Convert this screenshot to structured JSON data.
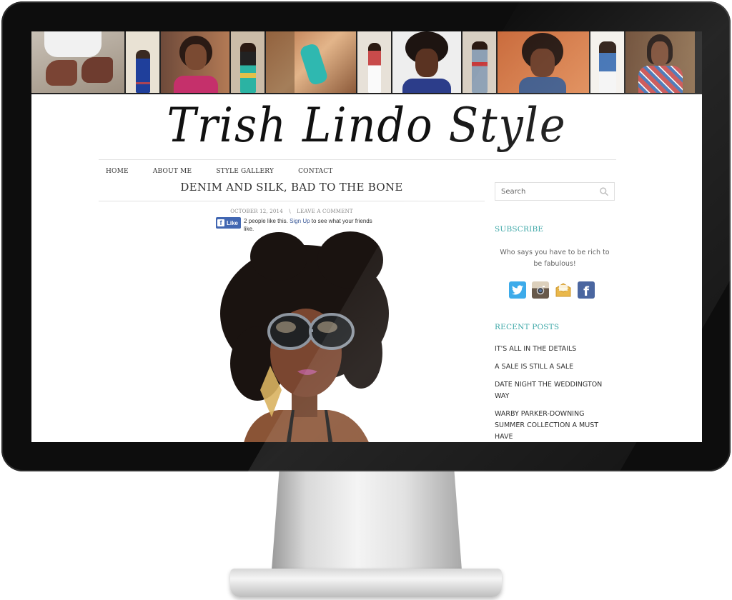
{
  "blog": {
    "title": "Trish Lindo Style"
  },
  "nav": {
    "items": [
      "HOME",
      "ABOUT ME",
      "STYLE GALLERY",
      "CONTACT"
    ]
  },
  "post": {
    "title": "DENIM AND SILK, BAD TO THE BONE",
    "date": "OCTOBER 12, 2014",
    "separator": "\\",
    "comment_link": "LEAVE A COMMENT",
    "fb": {
      "button": "Like",
      "count_text": "2 people like this.",
      "signup": "Sign Up",
      "rest": "to see what your friends like."
    }
  },
  "sidebar": {
    "search_placeholder": "Search",
    "subscribe_heading": "SUBSCRIBE",
    "subscribe_text": "Who says you have to be rich to be fabulous!",
    "social_icons": [
      "twitter-icon",
      "instagram-icon",
      "email-icon",
      "facebook-icon"
    ],
    "recent_heading": "RECENT POSTS",
    "recent_posts": [
      "IT'S ALL IN THE DETAILS",
      "A SALE IS STILL A SALE",
      "DATE NIGHT THE WEDDINGTON WAY",
      "WARBY PARKER-DOWNING SUMMER COLLECTION A MUST HAVE"
    ]
  },
  "colors": {
    "accent_teal": "#2a9f9f",
    "facebook_blue": "#4267b2",
    "twitter_blue": "#2aa3e8",
    "bezel": "#0d0d0d"
  }
}
